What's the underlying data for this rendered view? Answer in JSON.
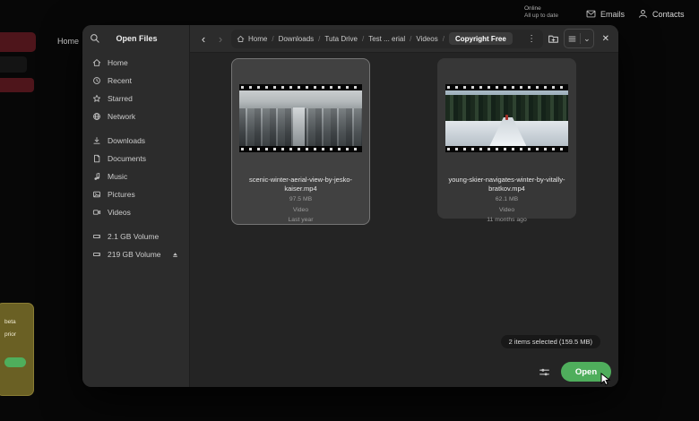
{
  "background": {
    "status": {
      "line1": "Online",
      "line2": "All up to date"
    },
    "emails_button": "Emails",
    "contacts_button": "Contacts",
    "home_tab": "Home",
    "notice": {
      "line1": "beta",
      "line2": "prior"
    }
  },
  "dialog": {
    "title": "Open Files",
    "nav": {
      "back": "‹",
      "forward": "›"
    },
    "breadcrumb_separator": "/",
    "breadcrumbs": [
      {
        "label": "Home",
        "icon": "home"
      },
      {
        "label": "Downloads"
      },
      {
        "label": "Tuta Drive"
      },
      {
        "label": "Test ... erial"
      },
      {
        "label": "Videos"
      },
      {
        "label": "Copyright Free",
        "current": true
      }
    ],
    "toolbar": {
      "kebab": "⋮",
      "new_folder_icon": "folder-plus",
      "view_icon": "list",
      "dropdown_chevron": "⌄",
      "close": "✕"
    },
    "sidebar": {
      "search_icon": "magnifier",
      "places": [
        {
          "label": "Home",
          "icon": "home"
        },
        {
          "label": "Recent",
          "icon": "clock"
        },
        {
          "label": "Starred",
          "icon": "star"
        },
        {
          "label": "Network",
          "icon": "network"
        }
      ],
      "folders": [
        {
          "label": "Downloads",
          "icon": "download-arrow"
        },
        {
          "label": "Documents",
          "icon": "document"
        },
        {
          "label": "Music",
          "icon": "music-note"
        },
        {
          "label": "Pictures",
          "icon": "picture"
        },
        {
          "label": "Videos",
          "icon": "video-camera"
        }
      ],
      "volumes": [
        {
          "label": "2.1 GB Volume",
          "icon": "drive",
          "ejectable": false
        },
        {
          "label": "219 GB Volume",
          "icon": "drive",
          "ejectable": true
        }
      ]
    },
    "files": [
      {
        "name": "scenic-winter-aerial-view-by-jesko-kaiser.mp4",
        "size": "97.5 MB",
        "type": "Video",
        "modified": "Last year",
        "selected": true
      },
      {
        "name": "young-skier-navigates-winter-by-vitally-bratkov.mp4",
        "size": "62.1 MB",
        "type": "Video",
        "modified": "11 months ago",
        "selected": true
      }
    ],
    "selection_status": "2 items selected (159.5 MB)",
    "open_button": "Open"
  },
  "colors": {
    "accent_green": "#4fae5c",
    "selection_red": "#4e151b",
    "notice_yellow": "#6a6024"
  }
}
